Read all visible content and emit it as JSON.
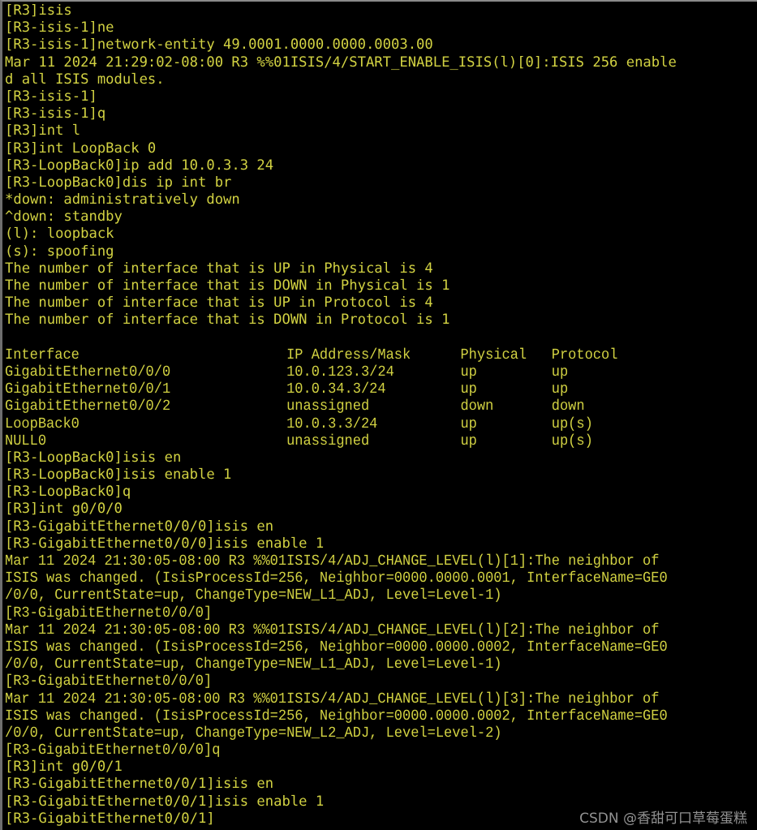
{
  "terminal": {
    "title": "Huawei eNSP router CLI session",
    "background_color": "#000000",
    "text_color": "#d2d242",
    "watermark_color": "#9a9a9a",
    "border_color": "#6e6e6e",
    "lines": [
      {
        "text": "[R3]isis",
        "style": "normal"
      },
      {
        "text": "[R3-isis-1]ne",
        "style": "normal"
      },
      {
        "text": "[R3-isis-1]network-entity 49.0001.0000.0000.0003.00",
        "style": "normal"
      },
      {
        "text": "Mar 11 2024 21:29:02-08:00 R3 %%01ISIS/4/START_ENABLE_ISIS(l)[0]:ISIS 256 enable",
        "style": "normal"
      },
      {
        "text": "d all ISIS modules.",
        "style": "normal"
      },
      {
        "text": "[R3-isis-1]",
        "style": "normal"
      },
      {
        "text": "[R3-isis-1]q",
        "style": "normal"
      },
      {
        "text": "[R3]int l",
        "style": "normal"
      },
      {
        "text": "[R3]int LoopBack 0",
        "style": "normal"
      },
      {
        "text": "[R3-LoopBack0]ip add 10.0.3.3 24",
        "style": "normal"
      },
      {
        "text": "[R3-LoopBack0]dis ip int br",
        "style": "normal"
      },
      {
        "text": "*down: administratively down",
        "style": "normal"
      },
      {
        "text": "^down: standby",
        "style": "normal"
      },
      {
        "text": "(l): loopback",
        "style": "normal"
      },
      {
        "text": "(s): spoofing",
        "style": "normal"
      },
      {
        "text": "The number of interface that is UP in Physical is 4",
        "style": "normal"
      },
      {
        "text": "The number of interface that is DOWN in Physical is 1",
        "style": "normal"
      },
      {
        "text": "The number of interface that is UP in Protocol is 4",
        "style": "normal"
      },
      {
        "text": "The number of interface that is DOWN in Protocol is 1",
        "style": "normal"
      },
      {
        "text": "",
        "style": "blank"
      },
      {
        "text": "Interface                         IP Address/Mask      Physical   Protocol",
        "style": "cond"
      },
      {
        "text": "GigabitEthernet0/0/0              10.0.123.3/24        up         up",
        "style": "cond"
      },
      {
        "text": "GigabitEthernet0/0/1              10.0.34.3/24         up         up",
        "style": "cond"
      },
      {
        "text": "GigabitEthernet0/0/2              unassigned           down       down",
        "style": "cond"
      },
      {
        "text": "LoopBack0                         10.0.3.3/24          up         up(s)",
        "style": "cond"
      },
      {
        "text": "NULL0                             unassigned           up         up(s)",
        "style": "cond"
      },
      {
        "text": "[R3-LoopBack0]isis en",
        "style": "normal"
      },
      {
        "text": "[R3-LoopBack0]isis enable 1",
        "style": "normal"
      },
      {
        "text": "[R3-LoopBack0]q",
        "style": "normal"
      },
      {
        "text": "[R3]int g0/0/0",
        "style": "normal"
      },
      {
        "text": "[R3-GigabitEthernet0/0/0]isis en",
        "style": "normal"
      },
      {
        "text": "[R3-GigabitEthernet0/0/0]isis enable 1",
        "style": "normal"
      },
      {
        "text": "Mar 11 2024 21:30:05-08:00 R3 %%01ISIS/4/ADJ_CHANGE_LEVEL(l)[1]:The neighbor of",
        "style": "cond"
      },
      {
        "text": "ISIS was changed. (IsisProcessId=256, Neighbor=0000.0000.0001, InterfaceName=GE0",
        "style": "cond"
      },
      {
        "text": "/0/0, CurrentState=up, ChangeType=NEW_L1_ADJ, Level=Level-1)",
        "style": "cond"
      },
      {
        "text": "[R3-GigabitEthernet0/0/0]",
        "style": "cond"
      },
      {
        "text": "Mar 11 2024 21:30:05-08:00 R3 %%01ISIS/4/ADJ_CHANGE_LEVEL(l)[2]:The neighbor of",
        "style": "cond"
      },
      {
        "text": "ISIS was changed. (IsisProcessId=256, Neighbor=0000.0000.0002, InterfaceName=GE0",
        "style": "cond"
      },
      {
        "text": "/0/0, CurrentState=up, ChangeType=NEW_L1_ADJ, Level=Level-1)",
        "style": "cond"
      },
      {
        "text": "[R3-GigabitEthernet0/0/0]",
        "style": "cond"
      },
      {
        "text": "Mar 11 2024 21:30:05-08:00 R3 %%01ISIS/4/ADJ_CHANGE_LEVEL(l)[3]:The neighbor of",
        "style": "cond"
      },
      {
        "text": "ISIS was changed. (IsisProcessId=256, Neighbor=0000.0000.0002, InterfaceName=GE0",
        "style": "cond"
      },
      {
        "text": "/0/0, CurrentState=up, ChangeType=NEW_L2_ADJ, Level=Level-2)",
        "style": "cond"
      },
      {
        "text": "[R3-GigabitEthernet0/0/0]q",
        "style": "cond"
      },
      {
        "text": "[R3]int g0/0/1",
        "style": "normal"
      },
      {
        "text": "[R3-GigabitEthernet0/0/1]isis en",
        "style": "normal"
      },
      {
        "text": "[R3-GigabitEthernet0/0/1]isis enable 1",
        "style": "normal"
      },
      {
        "text": "[R3-GigabitEthernet0/0/1]",
        "style": "normal"
      }
    ],
    "interface_table": {
      "headers": [
        "Interface",
        "IP Address/Mask",
        "Physical",
        "Protocol"
      ],
      "rows": [
        [
          "GigabitEthernet0/0/0",
          "10.0.123.3/24",
          "up",
          "up"
        ],
        [
          "GigabitEthernet0/0/1",
          "10.0.34.3/24",
          "up",
          "up"
        ],
        [
          "GigabitEthernet0/0/2",
          "unassigned",
          "down",
          "down"
        ],
        [
          "LoopBack0",
          "10.0.3.3/24",
          "up",
          "up(s)"
        ],
        [
          "NULL0",
          "unassigned",
          "up",
          "up(s)"
        ]
      ]
    },
    "legend": [
      "*down: administratively down",
      "^down: standby",
      "(l): loopback",
      "(s): spoofing"
    ],
    "counters": {
      "up_physical": "4",
      "down_physical": "1",
      "up_protocol": "4",
      "down_protocol": "1"
    }
  },
  "watermark": {
    "text": "CSDN @香甜可口草莓蛋糕"
  }
}
